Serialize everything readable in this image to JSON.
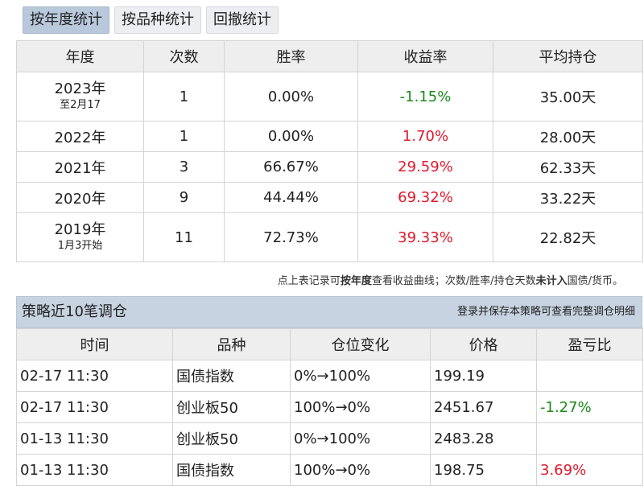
{
  "tabs": [
    {
      "label": "按年度统计",
      "active": true
    },
    {
      "label": "按品种统计",
      "active": false
    },
    {
      "label": "回撤统计",
      "active": false
    }
  ],
  "year_table": {
    "headers": [
      "年度",
      "次数",
      "胜率",
      "收益率",
      "平均持仓"
    ],
    "rows": [
      {
        "year": "2023年",
        "sub": "至2月17",
        "count": "1",
        "win": "0.00%",
        "ret": "-1.15%",
        "hold": "35.00天"
      },
      {
        "year": "2022年",
        "sub": "",
        "count": "1",
        "win": "0.00%",
        "ret": "1.70%",
        "hold": "28.00天"
      },
      {
        "year": "2021年",
        "sub": "",
        "count": "3",
        "win": "66.67%",
        "ret": "29.59%",
        "hold": "62.33天"
      },
      {
        "year": "2020年",
        "sub": "",
        "count": "9",
        "win": "44.44%",
        "ret": "69.32%",
        "hold": "33.22天"
      },
      {
        "year": "2019年",
        "sub": "1月3开始",
        "count": "11",
        "win": "72.73%",
        "ret": "39.33%",
        "hold": "22.82天"
      }
    ]
  },
  "note": {
    "p1": "点上表记录可",
    "b1": "按年度",
    "p2": "查看收益曲线；次数/胜率/持仓天数",
    "b2": "未计入",
    "p3": "国债/货币。"
  },
  "panel": {
    "title": "策略近10笔调仓",
    "link": "登录并保存本策略可查看完整调仓明细"
  },
  "trade_table": {
    "headers": [
      "时间",
      "品种",
      "仓位变化",
      "价格",
      "盈亏比"
    ],
    "rows": [
      {
        "time": "02-17 11:30",
        "asset": "国债指数",
        "change": "0%→100%",
        "price": "199.19",
        "pnl": ""
      },
      {
        "time": "02-17 11:30",
        "asset": "创业板50",
        "change": "100%→0%",
        "price": "2451.67",
        "pnl": "-1.27%"
      },
      {
        "time": "01-13 11:30",
        "asset": "创业板50",
        "change": "0%→100%",
        "price": "2483.28",
        "pnl": ""
      },
      {
        "time": "01-13 11:30",
        "asset": "国债指数",
        "change": "100%→0%",
        "price": "198.75",
        "pnl": "3.69%"
      }
    ]
  },
  "colors": {
    "positive": "#e0192b",
    "negative": "#1a8a1a",
    "active_tab": "#b9c9dc",
    "panel_header": "#c7d3e0"
  }
}
